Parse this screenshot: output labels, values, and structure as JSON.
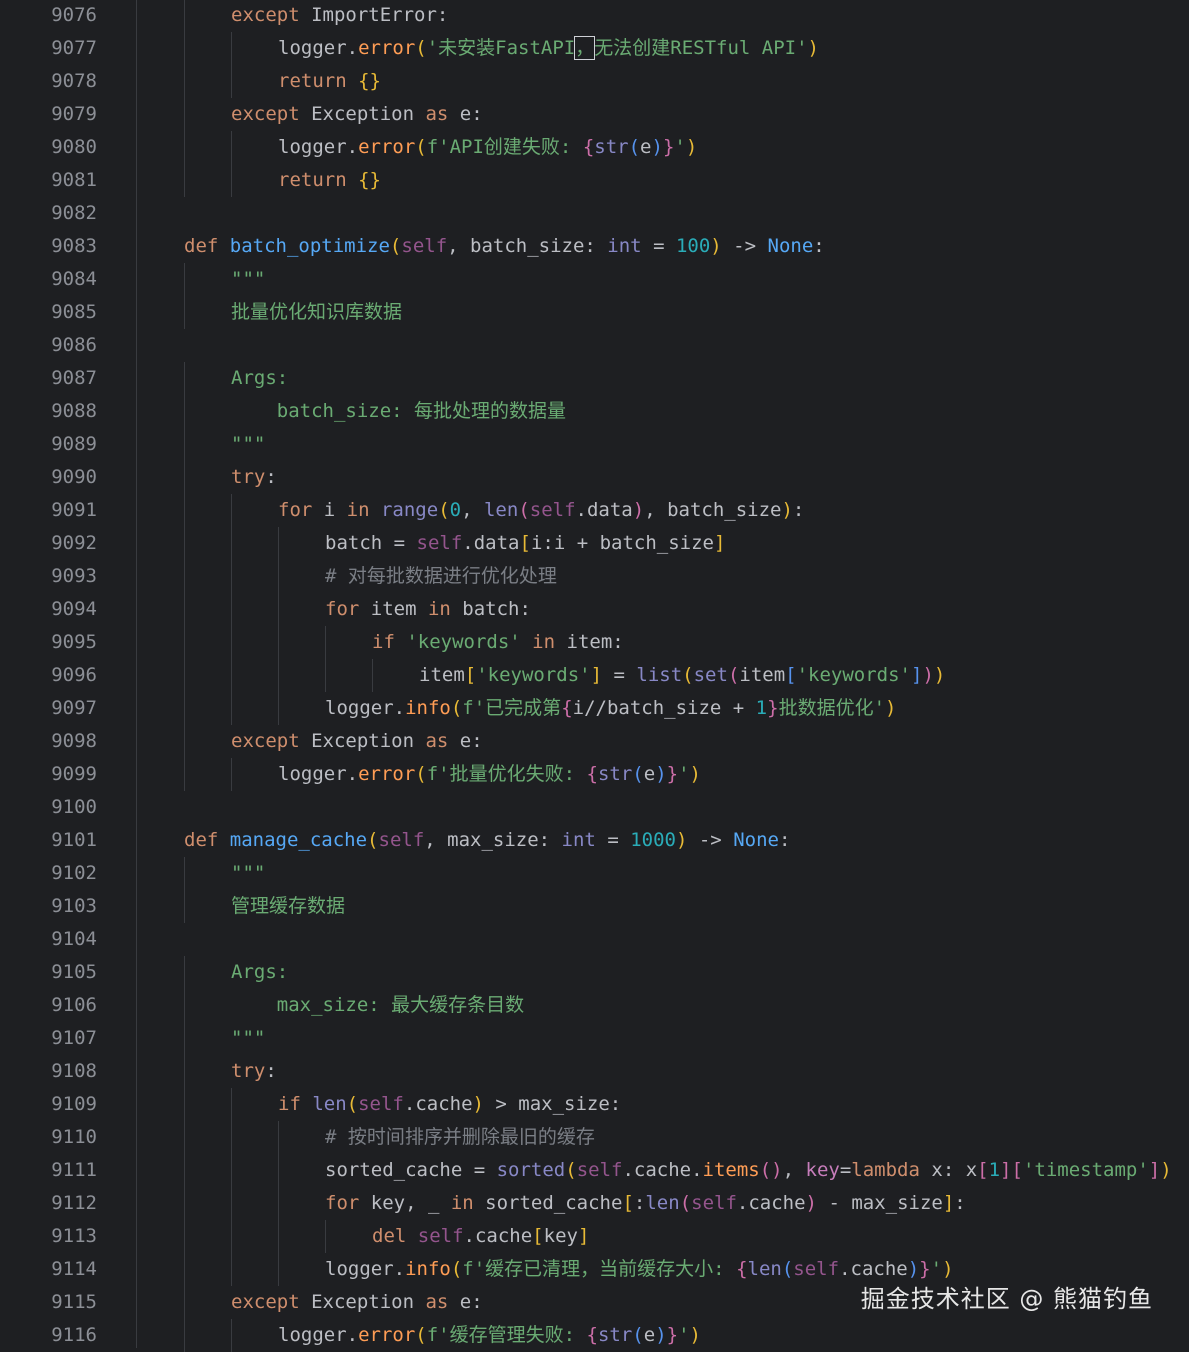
{
  "line_numbers": [
    "9076",
    "9077",
    "9078",
    "9079",
    "9080",
    "9081",
    "9082",
    "9083",
    "9084",
    "9085",
    "9086",
    "9087",
    "9088",
    "9089",
    "9090",
    "9091",
    "9092",
    "9093",
    "9094",
    "9095",
    "9096",
    "9097",
    "9098",
    "9099",
    "9100",
    "9101",
    "9102",
    "9103",
    "9104",
    "9105",
    "9106",
    "9107",
    "9108",
    "9109",
    "9110",
    "9111",
    "9112",
    "9113",
    "9114",
    "9115",
    "9116"
  ],
  "lines": [
    [
      [
        "kw",
        "except "
      ],
      [
        "cls",
        "ImportError"
      ],
      [
        "",
        ":"
      ]
    ],
    [
      [
        "",
        "logger."
      ],
      [
        "meth",
        "error"
      ],
      [
        "p1",
        "("
      ],
      [
        "str",
        "'未安装FastAPI"
      ],
      [
        "strcur",
        "，"
      ],
      [
        "str",
        "无法创建RESTful API'"
      ],
      [
        "p1",
        ")"
      ]
    ],
    [
      [
        "kw",
        "return "
      ],
      [
        "p1",
        "{}"
      ]
    ],
    [
      [
        "kw",
        "except "
      ],
      [
        "cls",
        "Exception "
      ],
      [
        "kw",
        "as "
      ],
      [
        "",
        "e:"
      ]
    ],
    [
      [
        "",
        "logger."
      ],
      [
        "meth",
        "error"
      ],
      [
        "p1",
        "("
      ],
      [
        "str",
        "f'API创建失败: "
      ],
      [
        "p2",
        "{"
      ],
      [
        "builtin",
        "str"
      ],
      [
        "p3",
        "("
      ],
      [
        "",
        "e"
      ],
      [
        "p3",
        ")"
      ],
      [
        "p2",
        "}"
      ],
      [
        "str",
        "'"
      ],
      [
        "p1",
        ")"
      ]
    ],
    [
      [
        "kw",
        "return "
      ],
      [
        "p1",
        "{}"
      ]
    ],
    [],
    [
      [
        "kw",
        "def "
      ],
      [
        "fn",
        "batch_optimize"
      ],
      [
        "p1",
        "("
      ],
      [
        "self",
        "self"
      ],
      [
        "",
        ", batch_size: "
      ],
      [
        "builtin",
        "int"
      ],
      [
        "",
        " = "
      ],
      [
        "num",
        "100"
      ],
      [
        "p1",
        ")"
      ],
      [
        "",
        " -> "
      ],
      [
        "fn",
        "None"
      ],
      [
        "",
        ":"
      ]
    ],
    [
      [
        "str",
        "\"\"\""
      ]
    ],
    [
      [
        "str",
        "批量优化知识库数据"
      ]
    ],
    [],
    [
      [
        "str",
        "Args:"
      ]
    ],
    [
      [
        "str",
        "    batch_size: 每批处理的数据量"
      ]
    ],
    [
      [
        "str",
        "\"\"\""
      ]
    ],
    [
      [
        "kw",
        "try"
      ],
      [
        "",
        ":"
      ]
    ],
    [
      [
        "kw",
        "for "
      ],
      [
        "",
        "i "
      ],
      [
        "kw",
        "in "
      ],
      [
        "builtin",
        "range"
      ],
      [
        "p1",
        "("
      ],
      [
        "num",
        "0"
      ],
      [
        "",
        ", "
      ],
      [
        "builtin",
        "len"
      ],
      [
        "p2",
        "("
      ],
      [
        "self",
        "self"
      ],
      [
        "",
        ".data"
      ],
      [
        "p2",
        ")"
      ],
      [
        "",
        ", batch_size"
      ],
      [
        "p1",
        ")"
      ],
      [
        "",
        ":"
      ]
    ],
    [
      [
        "",
        "batch = "
      ],
      [
        "self",
        "self"
      ],
      [
        "",
        ".data"
      ],
      [
        "p1",
        "["
      ],
      [
        "",
        "i:i + batch_size"
      ],
      [
        "p1",
        "]"
      ]
    ],
    [
      [
        "cmt",
        "# 对每批数据进行优化处理"
      ]
    ],
    [
      [
        "kw",
        "for "
      ],
      [
        "",
        "item "
      ],
      [
        "kw",
        "in "
      ],
      [
        "",
        "batch:"
      ]
    ],
    [
      [
        "kw",
        "if "
      ],
      [
        "str",
        "'keywords' "
      ],
      [
        "kw",
        "in "
      ],
      [
        "",
        "item:"
      ]
    ],
    [
      [
        "",
        "item"
      ],
      [
        "p1",
        "["
      ],
      [
        "str",
        "'keywords'"
      ],
      [
        "p1",
        "]"
      ],
      [
        "",
        " = "
      ],
      [
        "builtin",
        "list"
      ],
      [
        "p1",
        "("
      ],
      [
        "builtin",
        "set"
      ],
      [
        "p2",
        "("
      ],
      [
        "",
        "item"
      ],
      [
        "p3",
        "["
      ],
      [
        "str",
        "'keywords'"
      ],
      [
        "p3",
        "]"
      ],
      [
        "p2",
        ")"
      ],
      [
        "p1",
        ")"
      ]
    ],
    [
      [
        "",
        "logger."
      ],
      [
        "meth",
        "info"
      ],
      [
        "p1",
        "("
      ],
      [
        "str",
        "f'已完成第"
      ],
      [
        "p2",
        "{"
      ],
      [
        "",
        "i//batch_size + "
      ],
      [
        "num",
        "1"
      ],
      [
        "p2",
        "}"
      ],
      [
        "str",
        "批数据优化'"
      ],
      [
        "p1",
        ")"
      ]
    ],
    [
      [
        "kw",
        "except "
      ],
      [
        "cls",
        "Exception "
      ],
      [
        "kw",
        "as "
      ],
      [
        "",
        "e:"
      ]
    ],
    [
      [
        "",
        "logger."
      ],
      [
        "meth",
        "error"
      ],
      [
        "p1",
        "("
      ],
      [
        "str",
        "f'批量优化失败: "
      ],
      [
        "p2",
        "{"
      ],
      [
        "builtin",
        "str"
      ],
      [
        "p3",
        "("
      ],
      [
        "",
        "e"
      ],
      [
        "p3",
        ")"
      ],
      [
        "p2",
        "}"
      ],
      [
        "str",
        "'"
      ],
      [
        "p1",
        ")"
      ]
    ],
    [],
    [
      [
        "kw",
        "def "
      ],
      [
        "fn",
        "manage_cache"
      ],
      [
        "p1",
        "("
      ],
      [
        "self",
        "self"
      ],
      [
        "",
        ", max_size: "
      ],
      [
        "builtin",
        "int"
      ],
      [
        "",
        " = "
      ],
      [
        "num",
        "1000"
      ],
      [
        "p1",
        ")"
      ],
      [
        "",
        " -> "
      ],
      [
        "fn",
        "None"
      ],
      [
        "",
        ":"
      ]
    ],
    [
      [
        "str",
        "\"\"\""
      ]
    ],
    [
      [
        "str",
        "管理缓存数据"
      ]
    ],
    [],
    [
      [
        "str",
        "Args:"
      ]
    ],
    [
      [
        "str",
        "    max_size: 最大缓存条目数"
      ]
    ],
    [
      [
        "str",
        "\"\"\""
      ]
    ],
    [
      [
        "kw",
        "try"
      ],
      [
        "",
        ":"
      ]
    ],
    [
      [
        "kw",
        "if "
      ],
      [
        "builtin",
        "len"
      ],
      [
        "p1",
        "("
      ],
      [
        "self",
        "self"
      ],
      [
        "",
        ".cache"
      ],
      [
        "p1",
        ")"
      ],
      [
        "",
        " > max_size:"
      ]
    ],
    [
      [
        "cmt",
        "# 按时间排序并删除最旧的缓存"
      ]
    ],
    [
      [
        "",
        "sorted_cache = "
      ],
      [
        "builtin",
        "sorted"
      ],
      [
        "p1",
        "("
      ],
      [
        "self",
        "self"
      ],
      [
        "",
        ".cache."
      ],
      [
        "meth",
        "items"
      ],
      [
        "p2",
        "()"
      ],
      [
        "",
        ", "
      ],
      [
        "bi",
        "key"
      ],
      [
        "",
        "="
      ],
      [
        "kw",
        "lambda "
      ],
      [
        "",
        "x: x"
      ],
      [
        "p2",
        "["
      ],
      [
        "num",
        "1"
      ],
      [
        "p2",
        "]["
      ],
      [
        "str",
        "'timestamp'"
      ],
      [
        "p2",
        "]"
      ],
      [
        "p1",
        ")"
      ]
    ],
    [
      [
        "kw",
        "for "
      ],
      [
        "",
        "key, _ "
      ],
      [
        "kw",
        "in "
      ],
      [
        "",
        "sorted_cache"
      ],
      [
        "p1",
        "["
      ],
      [
        "",
        ":"
      ],
      [
        "builtin",
        "len"
      ],
      [
        "p2",
        "("
      ],
      [
        "self",
        "self"
      ],
      [
        "",
        ".cache"
      ],
      [
        "p2",
        ")"
      ],
      [
        "",
        " - max_size"
      ],
      [
        "p1",
        "]"
      ],
      [
        "",
        ":"
      ]
    ],
    [
      [
        "kw",
        "del "
      ],
      [
        "self",
        "self"
      ],
      [
        "",
        ".cache"
      ],
      [
        "p1",
        "["
      ],
      [
        "",
        "key"
      ],
      [
        "p1",
        "]"
      ]
    ],
    [
      [
        "",
        "logger."
      ],
      [
        "meth",
        "info"
      ],
      [
        "p1",
        "("
      ],
      [
        "str",
        "f'缓存已清理，当前缓存大小: "
      ],
      [
        "p2",
        "{"
      ],
      [
        "builtin",
        "len"
      ],
      [
        "p3",
        "("
      ],
      [
        "self",
        "self"
      ],
      [
        "",
        ".cache"
      ],
      [
        "p3",
        ")"
      ],
      [
        "p2",
        "}"
      ],
      [
        "str",
        "'"
      ],
      [
        "p1",
        ")"
      ]
    ],
    [
      [
        "kw",
        "except "
      ],
      [
        "cls",
        "Exception "
      ],
      [
        "kw",
        "as "
      ],
      [
        "",
        "e:"
      ]
    ],
    [
      [
        "",
        "logger."
      ],
      [
        "meth",
        "error"
      ],
      [
        "p1",
        "("
      ],
      [
        "str",
        "f'缓存管理失败: "
      ],
      [
        "p2",
        "{"
      ],
      [
        "builtin",
        "str"
      ],
      [
        "p3",
        "("
      ],
      [
        "",
        "e"
      ],
      [
        "p3",
        ")"
      ],
      [
        "p2",
        "}"
      ],
      [
        "str",
        "'"
      ],
      [
        "p1",
        ")"
      ]
    ]
  ],
  "watermark": "掘金技术社区 @ 熊猫钓鱼"
}
